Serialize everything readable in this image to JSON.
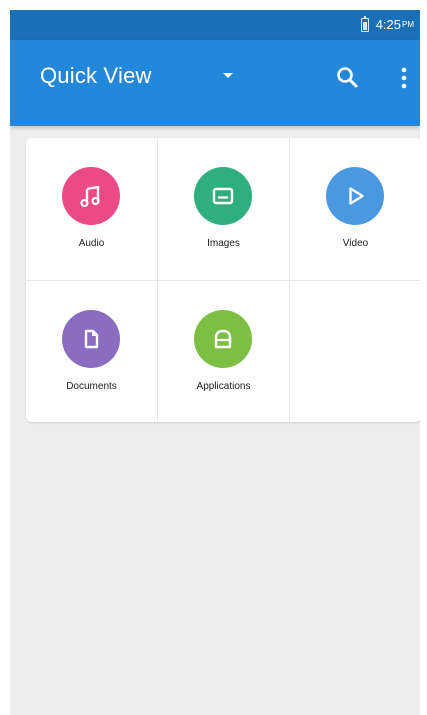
{
  "status_bar": {
    "time": "4:25",
    "ampm": "PM",
    "battery_icon": "battery-icon"
  },
  "app_bar": {
    "title": "Quick View",
    "dropdown_icon": "dropdown-arrow-icon",
    "search_icon": "search-icon",
    "more_icon": "more-vert-icon"
  },
  "categories": [
    {
      "label": "Audio",
      "icon": "music-note-icon",
      "color": "#ec4a86"
    },
    {
      "label": "Images",
      "icon": "image-icon",
      "color": "#2fae80"
    },
    {
      "label": "Video",
      "icon": "play-icon",
      "color": "#4a98e0"
    },
    {
      "label": "Documents",
      "icon": "document-icon",
      "color": "#8a6cc0"
    },
    {
      "label": "Applications",
      "icon": "apps-icon",
      "color": "#7cbf43"
    }
  ],
  "colors": {
    "status_bar": "#1a6fb6",
    "app_bar": "#2388d9",
    "background": "#ededed"
  }
}
